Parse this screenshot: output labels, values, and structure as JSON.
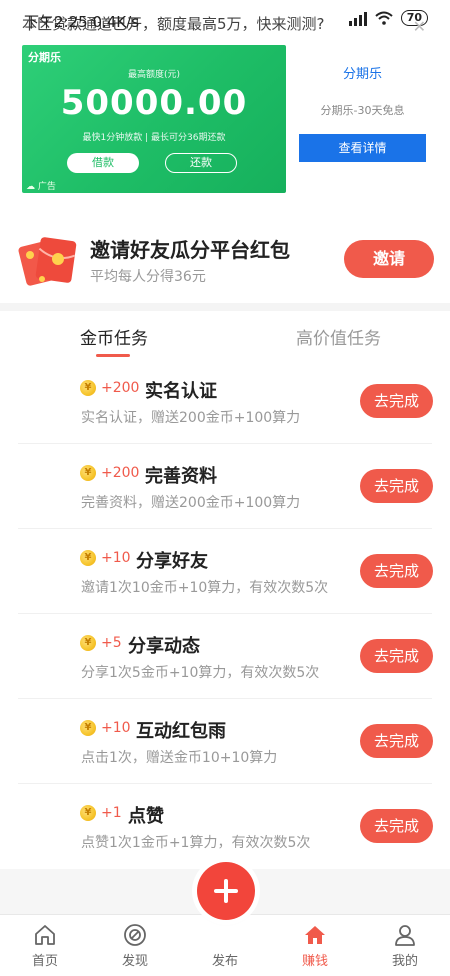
{
  "status_bar": {
    "left_text": "下午2:25 0.4K/s",
    "overlay_text": "本区贷款通道已开，额度最高5万，快来测测?",
    "battery": "70"
  },
  "ad": {
    "brand": "分期乐",
    "limit_label": "最高额度(元)",
    "amount": "50000.00",
    "desc": "最快1分钟放款 | 最长可分36期还款",
    "borrow_label": "借款",
    "repay_label": "还款",
    "tag": "广告",
    "side_title": "分期乐",
    "side_sub": "分期乐-30天免息",
    "detail_label": "查看详情"
  },
  "invite": {
    "title": "邀请好友瓜分平台红包",
    "subtitle": "平均每人分得36元",
    "button": "邀请"
  },
  "tabs": {
    "active": "金币任务",
    "other": "高价值任务"
  },
  "tasks": [
    {
      "reward": "+200",
      "title": "实名认证",
      "desc": "实名认证，赠送200金币+100算力",
      "button": "去完成"
    },
    {
      "reward": "+200",
      "title": "完善资料",
      "desc": "完善资料，赠送200金币+100算力",
      "button": "去完成"
    },
    {
      "reward": "+10",
      "title": "分享好友",
      "desc": "邀请1次10金币+10算力，有效次数5次",
      "button": "去完成"
    },
    {
      "reward": "+5",
      "title": "分享动态",
      "desc": "分享1次5金币+10算力，有效次数5次",
      "button": "去完成"
    },
    {
      "reward": "+10",
      "title": "互动红包雨",
      "desc": "点击1次，赠送金币10+10算力",
      "button": "去完成"
    },
    {
      "reward": "+1",
      "title": "点赞",
      "desc": "点赞1次1金币+1算力，有效次数5次",
      "button": "去完成"
    }
  ],
  "nav": {
    "items": [
      {
        "label": "首页",
        "icon": "home-outline-icon"
      },
      {
        "label": "发现",
        "icon": "compass-icon"
      },
      {
        "label": "发布",
        "icon": "plus-icon"
      },
      {
        "label": "赚钱",
        "icon": "home-filled-icon"
      },
      {
        "label": "我的",
        "icon": "user-icon"
      }
    ]
  },
  "colors": {
    "accent": "#f05a4b",
    "ad_green": "#1ebd66",
    "link_blue": "#1a73e8"
  }
}
